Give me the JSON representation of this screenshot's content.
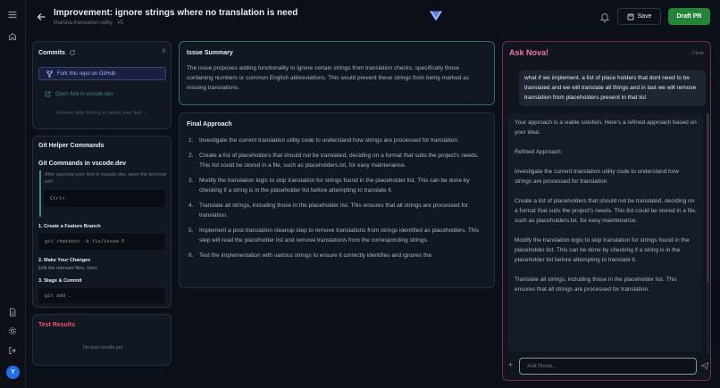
{
  "header": {
    "title": "Improvement: ignore strings where no translation is need",
    "subtitle": "lina/sha-translation-utility · #5",
    "save_label": "Save",
    "draft_pr_label": "Draft PR"
  },
  "rail": {
    "avatar_initial": "Y"
  },
  "commits": {
    "title": "Commits",
    "count": "0",
    "fork_button": "Fork this repo on GitHub",
    "open_fork_link": "Open fork in vscode.dev",
    "refresh_note": "Refresh after forking to detect your fork →"
  },
  "git_helper": {
    "title": "Git Helper Commands",
    "subtitle": "Git Commands in vscode.dev",
    "note": "After opening your fork in vscode.dev, open the terminal with",
    "shortcut": "Ctrl+`",
    "step1": "1. Create a Feature Branch",
    "step1_cmd": "git checkout -b fix/issue-5",
    "step2": "2. Make Your Changes",
    "step2_note": "Edit the relevant files, then:",
    "step3": "3. Stage & Commit",
    "step3_cmd": "git add ."
  },
  "tests": {
    "title": "Test Results",
    "empty": "No test results yet"
  },
  "issue_summary": {
    "title": "Issue Summary",
    "body": "The issue proposes adding functionality to ignore certain strings from translation checks, specifically those containing numbers or common English abbreviations. This would prevent these strings from being marked as missing translations."
  },
  "final_approach": {
    "title": "Final Approach",
    "steps": [
      {
        "n": "1.",
        "text": "Investigate the current translation utility code to understand how strings are processed for translation."
      },
      {
        "n": "2.",
        "text": "Create a list of placeholders that should not be translated, deciding on a format that suits the project's needs. This list could be stored in a file, such as placeholders.txt, for easy maintenance."
      },
      {
        "n": "3.",
        "text": "Modify the translation logic to skip translation for strings found in the placeholder list. This can be done by checking if a string is in the placeholder list before attempting to translate it."
      },
      {
        "n": "4.",
        "text": "Translate all strings, including those in the placeholder list. This ensures that all strings are processed for translation."
      },
      {
        "n": "5.",
        "text": "Implement a post-translation cleanup step to remove translations from strings identified as placeholders. This step will read the placeholder list and remove translations from the corresponding strings."
      },
      {
        "n": "6.",
        "text": "Test the implementation with various strings to ensure it correctly identifies and ignores the"
      }
    ]
  },
  "nova": {
    "title": "Ask Nova!",
    "clear_label": "Clear",
    "user_message": "what if we implement. a list of place holders that dont need to be translated and we will translate all things and in last we will remove translation from placeholders present in that list",
    "ai_paragraphs": [
      "Your approach is a viable solution. Here's a refined approach based on your idea:",
      "Refined Approach:",
      "Investigate the current translation utility code to understand how strings are processed for translation.",
      "Create a list of placeholders that should not be translated, deciding on a format that suits the project's needs. This list could be stored in a file, such as placeholders.txt, for easy maintenance.",
      "Modify the translation logic to skip translation for strings found in the placeholder list. This can be done by checking if a string is in the placeholder list before attempting to translate it.",
      "Translate all strings, including those in the placeholder list. This ensures that all strings are processed for translation."
    ],
    "input_placeholder": "Ask Nova..."
  }
}
